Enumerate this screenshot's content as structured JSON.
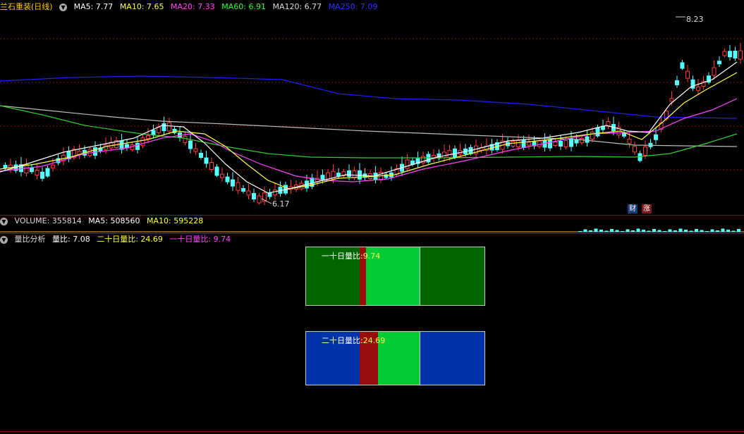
{
  "main_header": {
    "stock_name": "兰石重装(日线)",
    "ma5": "MA5: 7.77",
    "ma10": "MA10: 7.65",
    "ma20": "MA20: 7.33",
    "ma60": "MA60: 6.91",
    "ma120": "MA120: 6.77",
    "ma250": "MA250: 7.09"
  },
  "price_labels": {
    "high": "8.23",
    "low": "6.17"
  },
  "badges": {
    "finance": "财",
    "rise": "涨"
  },
  "volume_header": {
    "volume": "VOLUME: 355814",
    "ma5": "MA5: 508560",
    "ma10": "MA10: 595228"
  },
  "ratio_header": {
    "name": "量比分析",
    "ratio": "量比: 7.08",
    "ratio20": "二十日量比: 24.69",
    "ratio1": "一十日量比: 9.74"
  },
  "box_top": {
    "label": "一十日量比:",
    "value": "9.74"
  },
  "box_bottom": {
    "label": "二十日量比:",
    "value": "24.69"
  },
  "colors": {
    "up": "#ff3b3b",
    "down": "#54ffff",
    "ma5": "#ffffff",
    "ma10": "#ffff44",
    "ma20": "#ff44ff",
    "ma60": "#33cc33",
    "ma120": "#bbbbbb",
    "ma250": "#2020ff"
  }
}
